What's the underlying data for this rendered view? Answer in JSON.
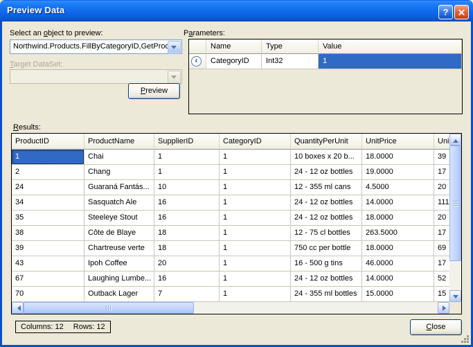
{
  "window": {
    "title": "Preview Data"
  },
  "icons": {
    "help": "?",
    "close": "x",
    "combo_arrow": "triangle-down",
    "param_direction": "‹",
    "scroll_up": "triangle-up",
    "scroll_down": "triangle-down",
    "scroll_left": "triangle-left",
    "scroll_right": "triangle-right"
  },
  "colors": {
    "selection": "#316AC5",
    "dialog_bg": "#ECE9D8",
    "titlebar_blue": "#0855D4",
    "close_button_red": "#D4501E",
    "grid_border": "#000000"
  },
  "object_picker": {
    "label": {
      "pre": "Select an ",
      "key": "o",
      "post": "bject to preview:"
    },
    "value": "Northwind.Products.FillByCategoryID,GetProd",
    "target_label": {
      "pre": "",
      "key": "T",
      "post": "arget DataSet:"
    },
    "target_value": "",
    "preview_button": {
      "pre": "",
      "key": "P",
      "post": "review"
    }
  },
  "parameters": {
    "label": {
      "pre": "P",
      "key": "a",
      "post": "rameters:"
    },
    "columns": [
      "Name",
      "Type",
      "Value"
    ],
    "rows": [
      {
        "name": "CategoryID",
        "type": "Int32",
        "value": "1"
      }
    ]
  },
  "results": {
    "label": {
      "pre": "",
      "key": "R",
      "post": "esults:"
    },
    "columns": [
      "ProductID",
      "ProductName",
      "SupplierID",
      "CategoryID",
      "QuantityPerUnit",
      "UnitPrice",
      "UnitsI"
    ],
    "rows": [
      [
        "1",
        "Chai",
        "1",
        "1",
        "10 boxes x 20 b...",
        "18.0000",
        "39"
      ],
      [
        "2",
        "Chang",
        "1",
        "1",
        "24 - 12 oz bottles",
        "19.0000",
        "17"
      ],
      [
        "24",
        "Guaraná Fantás...",
        "10",
        "1",
        "12 - 355 ml cans",
        "4.5000",
        "20"
      ],
      [
        "34",
        "Sasquatch Ale",
        "16",
        "1",
        "24 - 12 oz bottles",
        "14.0000",
        "111"
      ],
      [
        "35",
        "Steeleye Stout",
        "16",
        "1",
        "24 - 12 oz bottles",
        "18.0000",
        "20"
      ],
      [
        "38",
        "Côte de Blaye",
        "18",
        "1",
        "12 - 75 cl bottles",
        "263.5000",
        "17"
      ],
      [
        "39",
        "Chartreuse verte",
        "18",
        "1",
        "750 cc per bottle",
        "18.0000",
        "69"
      ],
      [
        "43",
        "Ipoh Coffee",
        "20",
        "1",
        "16 - 500 g tins",
        "46.0000",
        "17"
      ],
      [
        "67",
        "Laughing Lumbe...",
        "16",
        "1",
        "24 - 12 oz bottles",
        "14.0000",
        "52"
      ],
      [
        "70",
        "Outback Lager",
        "7",
        "1",
        "24 - 355 ml bottles",
        "15.0000",
        "15"
      ]
    ]
  },
  "status": {
    "columns_text": "Columns: 12",
    "rows_text": "Rows: 12"
  },
  "close_button": {
    "pre": "",
    "key": "C",
    "post": "lose"
  }
}
